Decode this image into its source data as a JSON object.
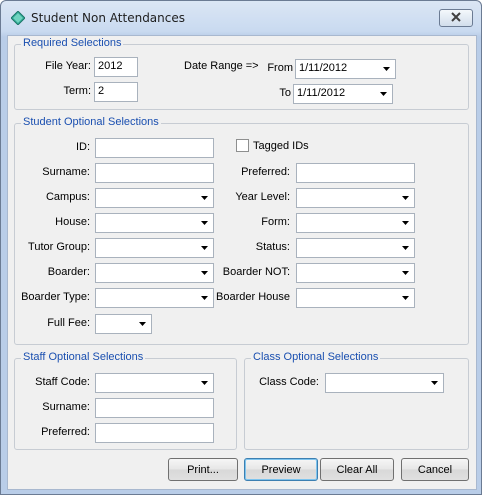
{
  "window": {
    "title": "Student Non Attendances",
    "app_icon": "diamond-icon",
    "close_icon": "close-icon"
  },
  "required": {
    "title": "Required Selections",
    "file_year_label": "File Year:",
    "file_year_value": "2012",
    "term_label": "Term:",
    "term_value": "2",
    "date_range_label": "Date Range =>",
    "from_label": "From",
    "from_value": "1/11/2012",
    "to_label": "To",
    "to_value": "1/11/2012"
  },
  "student": {
    "title": "Student Optional Selections",
    "id_label": "ID:",
    "tagged_label": "Tagged IDs",
    "surname_label": "Surname:",
    "preferred_label": "Preferred:",
    "campus_label": "Campus:",
    "year_level_label": "Year Level:",
    "house_label": "House:",
    "form_label": "Form:",
    "tutor_group_label": "Tutor Group:",
    "status_label": "Status:",
    "boarder_label": "Boarder:",
    "boarder_not_label": "Boarder NOT:",
    "boarder_type_label": "Boarder Type:",
    "boarder_house_label": "Boarder House",
    "full_fee_label": "Full Fee:"
  },
  "staff": {
    "title": "Staff Optional Selections",
    "staff_code_label": "Staff Code:",
    "surname_label": "Surname:",
    "preferred_label": "Preferred:"
  },
  "class": {
    "title": "Class Optional Selections",
    "class_code_label": "Class Code:"
  },
  "buttons": {
    "print": "Print...",
    "preview": "Preview",
    "clear_all": "Clear All",
    "cancel": "Cancel"
  }
}
